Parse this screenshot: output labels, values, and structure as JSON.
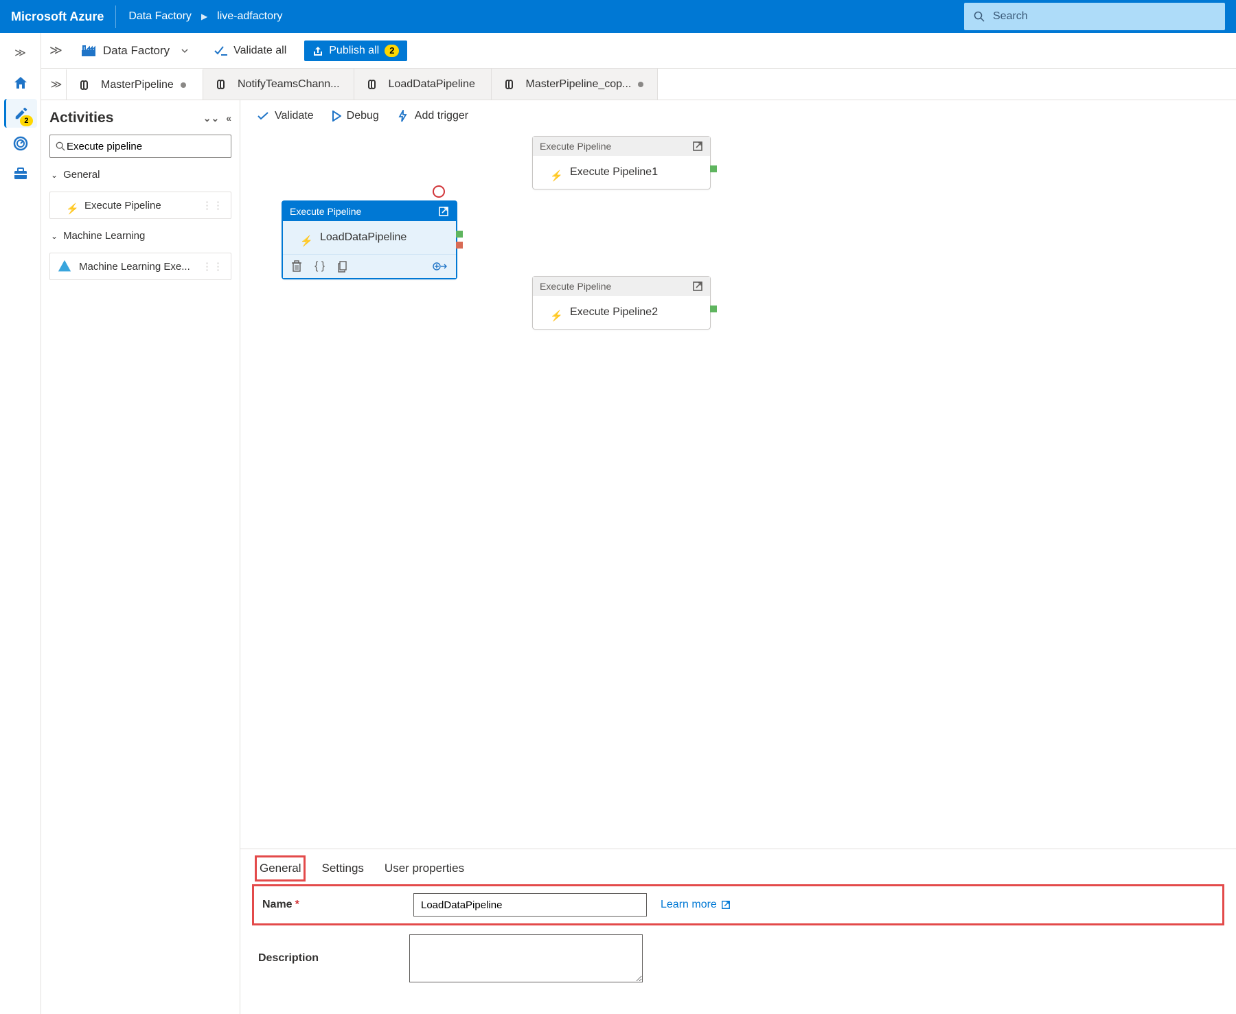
{
  "header": {
    "brand": "Microsoft Azure",
    "crumb1": "Data Factory",
    "crumb2": "live-adfactory",
    "search_placeholder": "Search"
  },
  "toolbar": {
    "service_label": "Data Factory",
    "validate_all": "Validate all",
    "publish_all": "Publish all",
    "publish_count": "2"
  },
  "tabs": [
    {
      "label": "MasterPipeline",
      "dirty": true
    },
    {
      "label": "NotifyTeamsChann...",
      "dirty": false
    },
    {
      "label": "LoadDataPipeline",
      "dirty": false
    },
    {
      "label": "MasterPipeline_cop...",
      "dirty": true
    }
  ],
  "activities": {
    "title": "Activities",
    "search_value": "Execute pipeline",
    "cat_general": "General",
    "item_general": "Execute Pipeline",
    "cat_ml": "Machine Learning",
    "item_ml": "Machine Learning Exe..."
  },
  "canvas_toolbar": {
    "validate": "Validate",
    "debug": "Debug",
    "add_trigger": "Add trigger"
  },
  "nodes": {
    "sel": {
      "head": "Execute Pipeline",
      "body": "LoadDataPipeline"
    },
    "n1": {
      "head": "Execute Pipeline",
      "body": "Execute Pipeline1"
    },
    "n2": {
      "head": "Execute Pipeline",
      "body": "Execute Pipeline2"
    }
  },
  "props": {
    "tab_general": "General",
    "tab_settings": "Settings",
    "tab_user": "User properties",
    "name_label": "Name",
    "name_value": "LoadDataPipeline",
    "desc_label": "Description",
    "desc_value": "",
    "learn_more": "Learn more"
  },
  "rail_badge": "2"
}
